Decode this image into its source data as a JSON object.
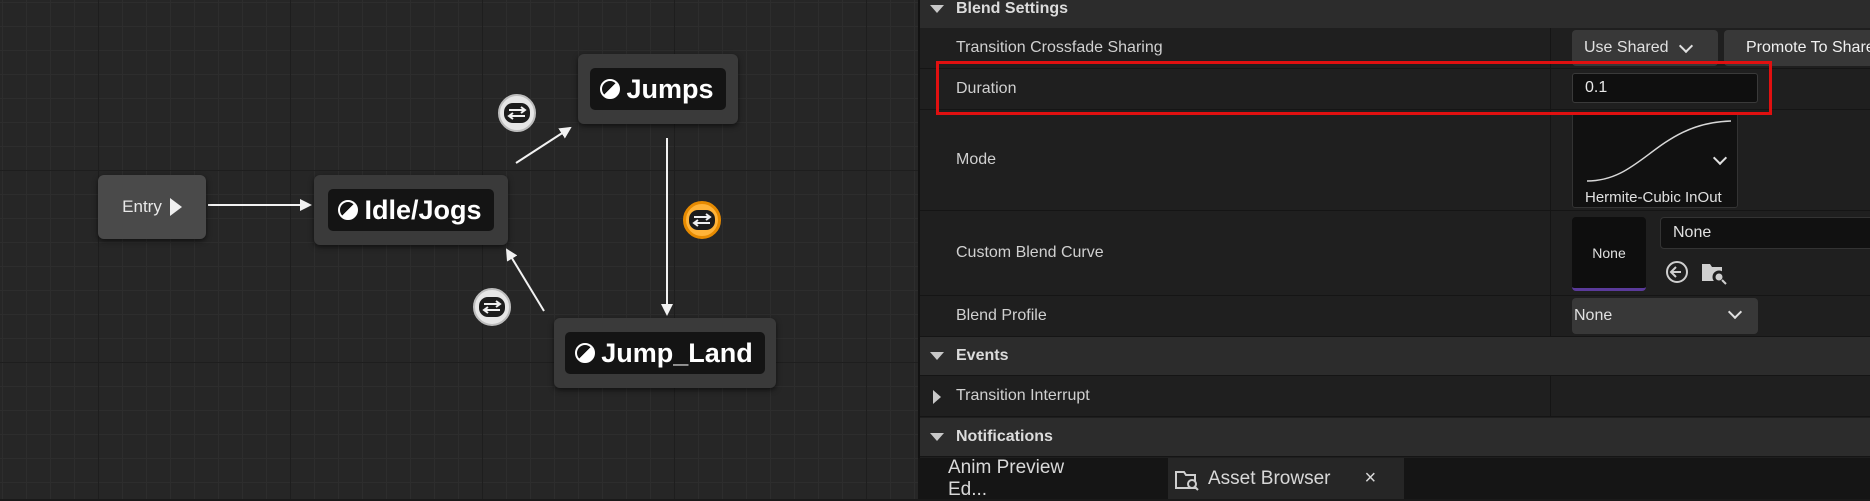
{
  "graph": {
    "entry_label": "Entry",
    "states": [
      {
        "id": "idle",
        "label": "Idle/Jogs"
      },
      {
        "id": "jumps",
        "label": "Jumps"
      },
      {
        "id": "jump_land",
        "label": "Jump_Land"
      }
    ]
  },
  "details": {
    "sections": {
      "blend_settings": "Blend Settings",
      "events": "Events",
      "notifications": "Notifications"
    },
    "crossfade_sharing": {
      "label": "Transition Crossfade Sharing",
      "value": "Use Shared",
      "promote_button": "Promote To Shared"
    },
    "duration": {
      "label": "Duration",
      "value": "0.1"
    },
    "mode": {
      "label": "Mode",
      "value": "Hermite-Cubic InOut"
    },
    "custom_blend_curve": {
      "label": "Custom Blend Curve",
      "thumbnail": "None",
      "asset": "None"
    },
    "blend_profile": {
      "label": "Blend Profile",
      "value": "None"
    },
    "transition_interrupt": {
      "label": "Transition Interrupt"
    }
  },
  "tabs": [
    {
      "label": "Anim Preview Ed..."
    },
    {
      "label": "Asset Browser",
      "close": "×"
    }
  ],
  "colors": {
    "highlight": "#e01010",
    "active_transition": "#ffb338",
    "accent_underline": "#5a3a9a"
  }
}
